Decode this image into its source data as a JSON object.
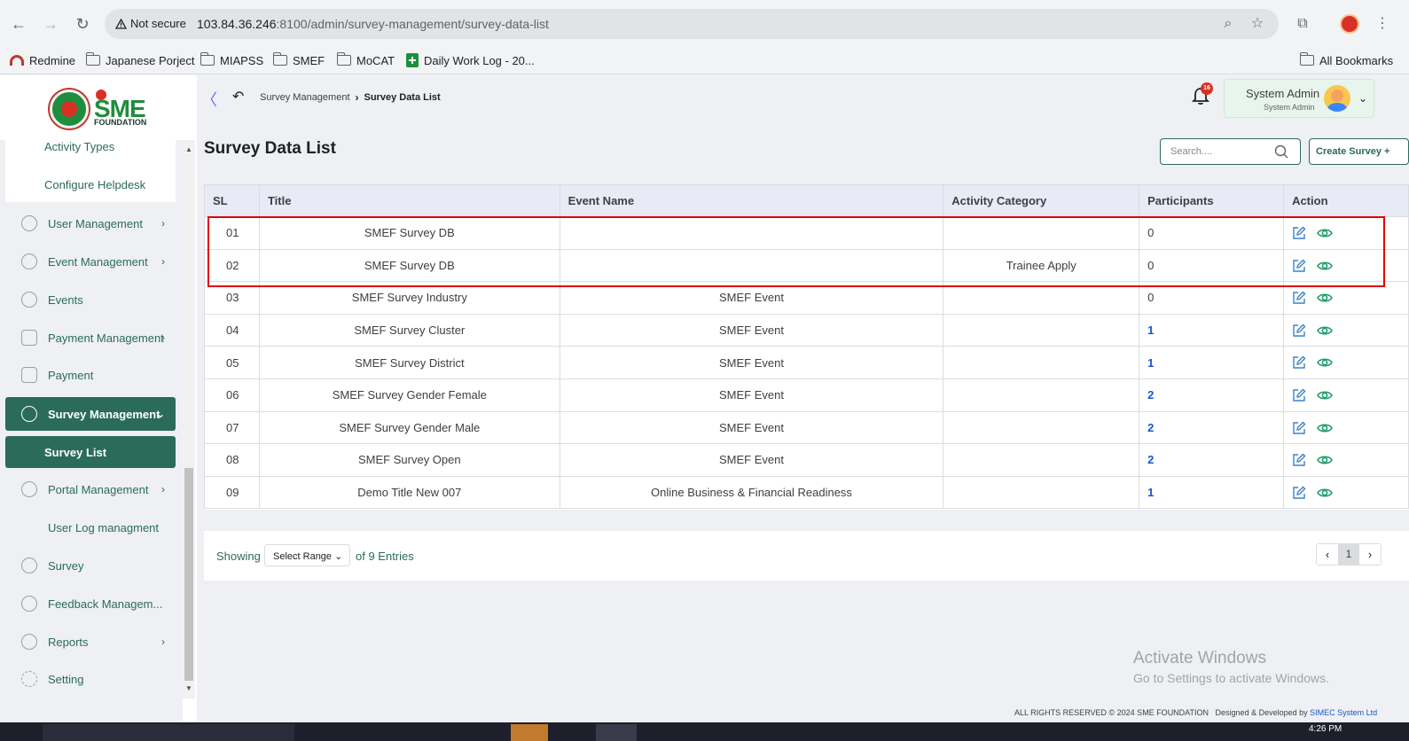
{
  "browser": {
    "not_secure": "Not secure",
    "url_host": "103.84.36.246",
    "url_rest": ":8100/admin/survey-management/survey-data-list",
    "bookmarks": [
      "Redmine",
      "Japanese Porject",
      "MIAPSS",
      "SMEF",
      "MoCAT",
      "Daily Work Log - 20...",
      "All Bookmarks"
    ]
  },
  "logo": {
    "text": "SME",
    "subtext": "FOUNDATION"
  },
  "sidebar": {
    "submenu": [
      "Activity Types",
      "Configure Helpdesk"
    ],
    "items": [
      {
        "label": "User Management",
        "chevron": "›"
      },
      {
        "label": "Event Management",
        "chevron": "›"
      },
      {
        "label": "Events",
        "chevron": ""
      },
      {
        "label": "Payment Management",
        "chevron": "›"
      },
      {
        "label": "Payment",
        "chevron": ""
      },
      {
        "label": "Survey Management",
        "chevron": "⌄"
      },
      {
        "label": "Survey List",
        "chevron": ""
      },
      {
        "label": "Portal Management",
        "chevron": "›"
      },
      {
        "label": "User Log managment",
        "chevron": ""
      },
      {
        "label": "Survey",
        "chevron": ""
      },
      {
        "label": "Feedback Managem...",
        "chevron": ""
      },
      {
        "label": "Reports",
        "chevron": "›"
      },
      {
        "label": "Setting",
        "chevron": ""
      }
    ]
  },
  "topbar": {
    "breadcrumb": [
      "Survey Management",
      "Survey Data List"
    ],
    "notification_count": "16",
    "user": {
      "name": "System Admin",
      "role": "System Admin"
    }
  },
  "main": {
    "title": "Survey Data List",
    "search_placeholder": "Search....",
    "create_button": "Create Survey +",
    "table": {
      "headers": [
        "SL",
        "Title",
        "Event Name",
        "Activity Category",
        "Participants",
        "Action"
      ],
      "rows": [
        {
          "sl": "01",
          "title": "SMEF Survey DB",
          "event": "",
          "category": "",
          "participants": "0"
        },
        {
          "sl": "02",
          "title": "SMEF Survey DB",
          "event": "",
          "category": "Trainee Apply",
          "participants": "0"
        },
        {
          "sl": "03",
          "title": "SMEF Survey Industry",
          "event": "SMEF Event",
          "category": "",
          "participants": "0"
        },
        {
          "sl": "04",
          "title": "SMEF Survey Cluster",
          "event": "SMEF Event",
          "category": "",
          "participants": "1"
        },
        {
          "sl": "05",
          "title": "SMEF Survey District",
          "event": "SMEF Event",
          "category": "",
          "participants": "1"
        },
        {
          "sl": "06",
          "title": "SMEF Survey Gender Female",
          "event": "SMEF Event",
          "category": "",
          "participants": "2"
        },
        {
          "sl": "07",
          "title": "SMEF Survey Gender Male",
          "event": "SMEF Event",
          "category": "",
          "participants": "2"
        },
        {
          "sl": "08",
          "title": "SMEF Survey Open",
          "event": "SMEF Event",
          "category": "",
          "participants": "2"
        },
        {
          "sl": "09",
          "title": "Demo Title New 007",
          "event": "Online Business & Financial Readiness",
          "category": "",
          "participants": "1"
        }
      ]
    },
    "pagination": {
      "showing": "Showing",
      "range_select": "Select Range",
      "entries": "of 9 Entries",
      "prev": "‹",
      "current_page": "1",
      "next": "›"
    }
  },
  "watermark": {
    "title": "Activate Windows",
    "subtitle": "Go to Settings to activate Windows."
  },
  "footer": {
    "copyright": "ALL RIGHTS RESERVED © 2024 SME FOUNDATION",
    "designed": "Designed & Developed by",
    "company": "SIMEC System Ltd"
  },
  "taskbar": {
    "time": "4:26 PM"
  },
  "colors": {
    "primary": "#2a6b5a",
    "link": "#1a56c7",
    "highlight": "#e00000"
  }
}
